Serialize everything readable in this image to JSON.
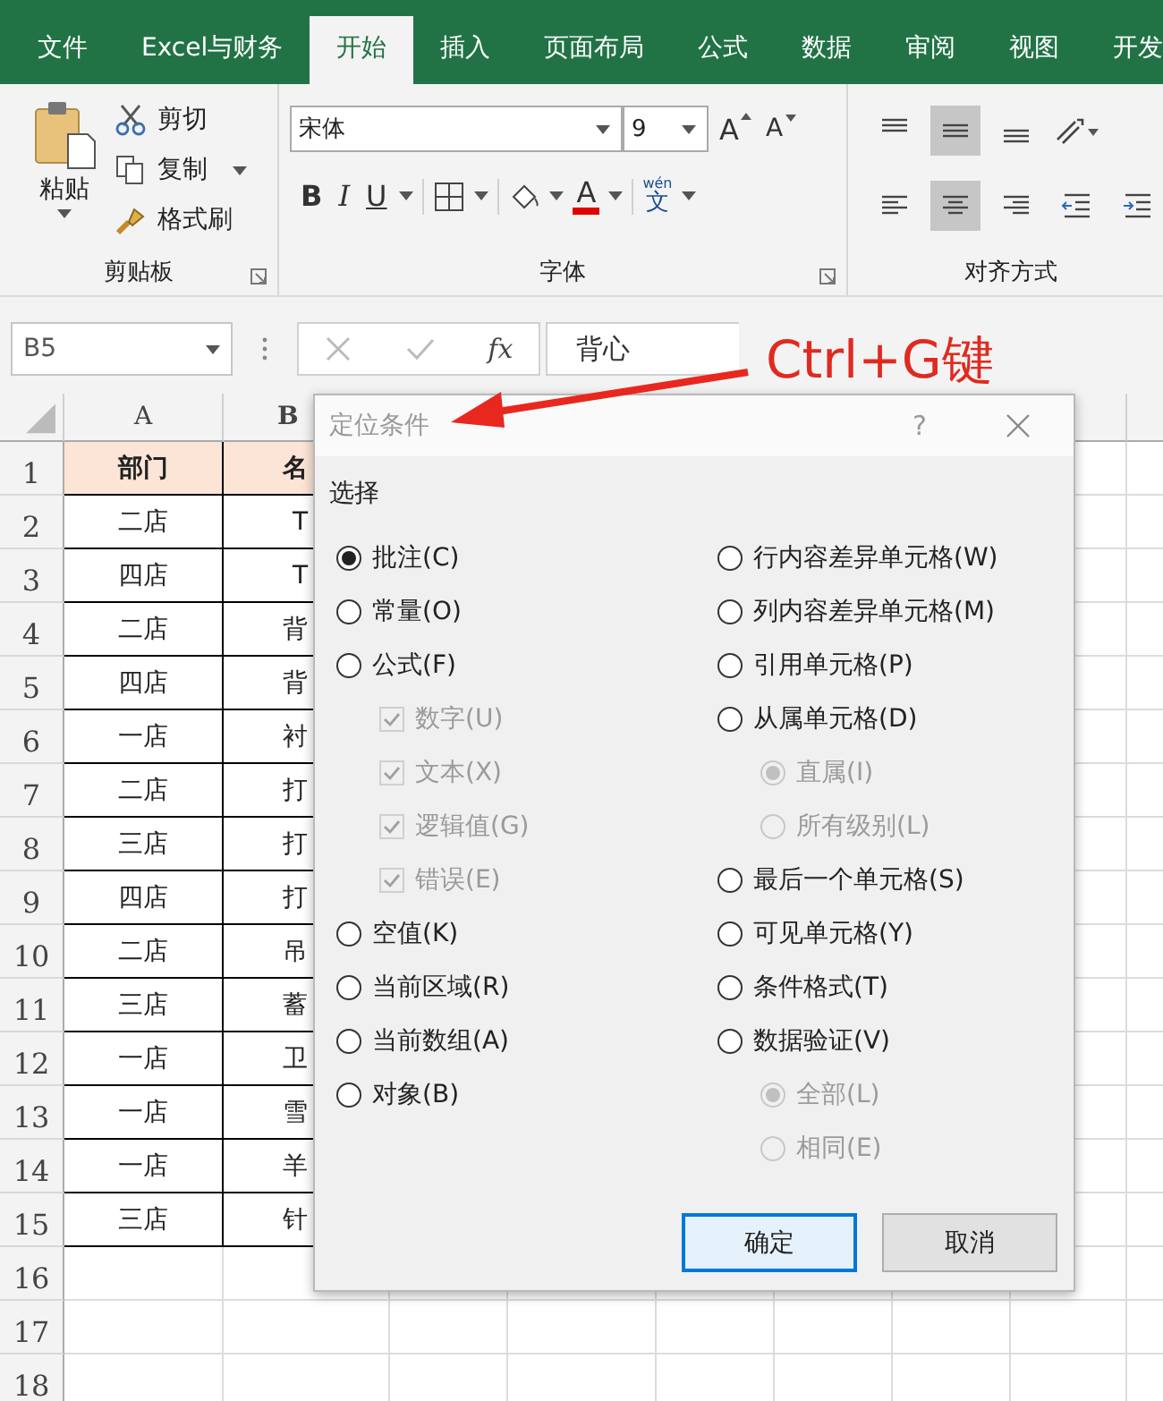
{
  "ribbon_tabs": [
    {
      "label": "文件",
      "selected": false
    },
    {
      "label": "Excel与财务",
      "selected": false
    },
    {
      "label": "开始",
      "selected": true
    },
    {
      "label": "插入",
      "selected": false
    },
    {
      "label": "页面布局",
      "selected": false
    },
    {
      "label": "公式",
      "selected": false
    },
    {
      "label": "数据",
      "selected": false
    },
    {
      "label": "审阅",
      "selected": false
    },
    {
      "label": "视图",
      "selected": false
    },
    {
      "label": "开发",
      "selected": false
    }
  ],
  "clipboard": {
    "paste": "粘贴",
    "cut": "剪切",
    "copy": "复制",
    "format_painter": "格式刷",
    "group_label": "剪贴板"
  },
  "font": {
    "font_name": "宋体",
    "font_size": "9",
    "grow": "A",
    "shrink": "A",
    "bold": "B",
    "italic": "I",
    "underline": "U",
    "font_color": "A",
    "phonetic_top": "wén",
    "phonetic": "文",
    "group_label": "字体"
  },
  "alignment": {
    "group_label": "对齐方式",
    "buttons": [
      {
        "kind": "top",
        "on": false
      },
      {
        "kind": "middle",
        "on": true
      },
      {
        "kind": "bottom",
        "on": false
      },
      {
        "kind": "orient",
        "on": false
      },
      {
        "kind": "left",
        "on": false
      },
      {
        "kind": "center",
        "on": true
      },
      {
        "kind": "right",
        "on": false
      },
      {
        "kind": "outdent",
        "on": false
      },
      {
        "kind": "indent",
        "on": false
      }
    ]
  },
  "name_box": "B5",
  "fx": "fx",
  "formula": "背心",
  "callout": "Ctrl+G键",
  "sheet": {
    "columns": [
      "A",
      "B"
    ],
    "row_numbers": [
      "1",
      "2",
      "3",
      "4",
      "5",
      "6",
      "7",
      "8",
      "9",
      "10",
      "11",
      "12",
      "13",
      "14",
      "15",
      "16",
      "17",
      "18"
    ],
    "rows": [
      [
        "部门",
        "名"
      ],
      [
        "二店",
        "T"
      ],
      [
        "四店",
        "T"
      ],
      [
        "二店",
        "背"
      ],
      [
        "四店",
        "背"
      ],
      [
        "一店",
        "衬"
      ],
      [
        "二店",
        "打"
      ],
      [
        "三店",
        "打"
      ],
      [
        "四店",
        "打"
      ],
      [
        "二店",
        "吊"
      ],
      [
        "三店",
        "蓄"
      ],
      [
        "一店",
        "卫"
      ],
      [
        "一店",
        "雪"
      ],
      [
        "一店",
        "羊"
      ],
      [
        "三店",
        "针"
      ]
    ]
  },
  "dialog": {
    "title": "定位条件",
    "help": "?",
    "group_label": "选择",
    "left": [
      {
        "kind": "radio",
        "label": "批注(C)",
        "selected": true,
        "disabled": false
      },
      {
        "kind": "radio",
        "label": "常量(O)",
        "selected": false,
        "disabled": false
      },
      {
        "kind": "radio",
        "label": "公式(F)",
        "selected": false,
        "disabled": false,
        "children": [
          {
            "kind": "checkbox",
            "label": "数字(U)",
            "checked": true,
            "disabled": true
          },
          {
            "kind": "checkbox",
            "label": "文本(X)",
            "checked": true,
            "disabled": true
          },
          {
            "kind": "checkbox",
            "label": "逻辑值(G)",
            "checked": true,
            "disabled": true
          },
          {
            "kind": "checkbox",
            "label": "错误(E)",
            "checked": true,
            "disabled": true
          }
        ]
      },
      {
        "kind": "radio",
        "label": "空值(K)",
        "selected": false,
        "disabled": false
      },
      {
        "kind": "radio",
        "label": "当前区域(R)",
        "selected": false,
        "disabled": false
      },
      {
        "kind": "radio",
        "label": "当前数组(A)",
        "selected": false,
        "disabled": false
      },
      {
        "kind": "radio",
        "label": "对象(B)",
        "selected": false,
        "disabled": false
      }
    ],
    "right": [
      {
        "kind": "radio",
        "label": "行内容差异单元格(W)",
        "selected": false,
        "disabled": false
      },
      {
        "kind": "radio",
        "label": "列内容差异单元格(M)",
        "selected": false,
        "disabled": false
      },
      {
        "kind": "radio",
        "label": "引用单元格(P)",
        "selected": false,
        "disabled": false
      },
      {
        "kind": "radio",
        "label": "从属单元格(D)",
        "selected": false,
        "disabled": false,
        "children": [
          {
            "kind": "radio",
            "label": "直属(I)",
            "selected": true,
            "disabled": true
          },
          {
            "kind": "radio",
            "label": "所有级别(L)",
            "selected": false,
            "disabled": true
          }
        ]
      },
      {
        "kind": "radio",
        "label": "最后一个单元格(S)",
        "selected": false,
        "disabled": false
      },
      {
        "kind": "radio",
        "label": "可见单元格(Y)",
        "selected": false,
        "disabled": false
      },
      {
        "kind": "radio",
        "label": "条件格式(T)",
        "selected": false,
        "disabled": false
      },
      {
        "kind": "radio",
        "label": "数据验证(V)",
        "selected": false,
        "disabled": false,
        "children": [
          {
            "kind": "radio",
            "label": "全部(L)",
            "selected": true,
            "disabled": true
          },
          {
            "kind": "radio",
            "label": "相同(E)",
            "selected": false,
            "disabled": true
          }
        ]
      }
    ],
    "buttons": [
      {
        "label": "确定",
        "default": true
      },
      {
        "label": "取消",
        "default": false
      }
    ]
  }
}
